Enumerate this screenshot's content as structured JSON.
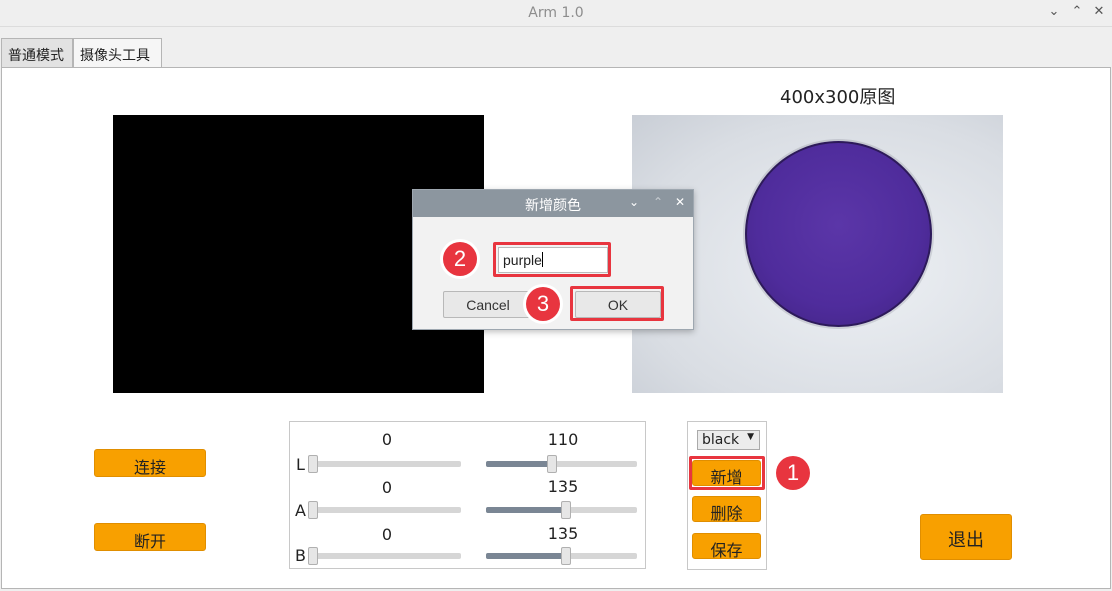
{
  "window": {
    "title": "Arm 1.0",
    "controls": {
      "minimize": "⌄",
      "maximize": "⌃",
      "close": "✕"
    }
  },
  "tabs": [
    {
      "label": "普通模式"
    },
    {
      "label": "摄像头工具"
    }
  ],
  "left_buttons": {
    "connect": "连接",
    "disconnect": "断开"
  },
  "image_title": "400x300原图",
  "sliders": {
    "L": {
      "label": "L",
      "min_value": "0",
      "max_value": "110"
    },
    "A": {
      "label": "A",
      "min_value": "0",
      "max_value": "135"
    },
    "B": {
      "label": "B",
      "min_value": "0",
      "max_value": "135"
    }
  },
  "color_panel": {
    "selected": "black",
    "add": "新增",
    "delete": "删除",
    "save": "保存"
  },
  "exit_button": "退出",
  "dialog": {
    "title": "新增颜色",
    "input_value": "purple",
    "cancel": "Cancel",
    "ok": "OK"
  },
  "annotations": {
    "step1": "1",
    "step2": "2",
    "step3": "3"
  },
  "colors": {
    "accent": "#f8a000",
    "highlight": "#e8353f",
    "dialog_title": "#8c969f"
  }
}
